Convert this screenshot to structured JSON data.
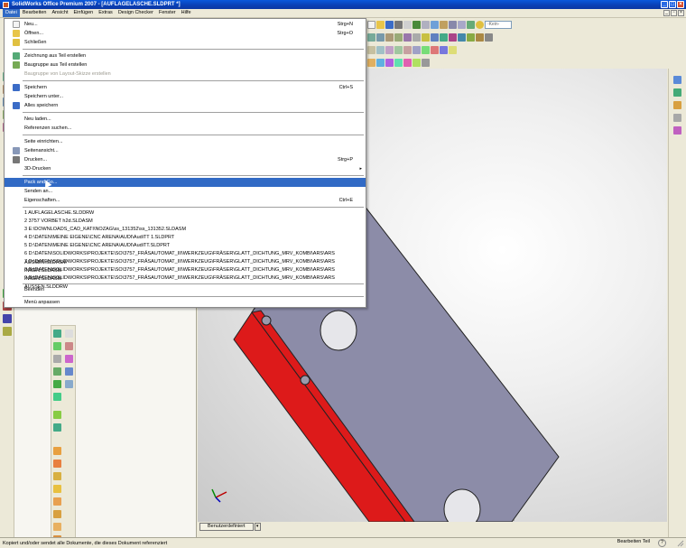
{
  "window": {
    "title": "SolidWorks Office Premium 2007 - [AUFLAGELASCHE.SLDPRT *]"
  },
  "menubar": {
    "items": [
      "Datei",
      "Bearbeiten",
      "Ansicht",
      "Einfügen",
      "Extras",
      "Design Checker",
      "Fenster",
      "Hilfe"
    ]
  },
  "toolbar": {
    "zoom_placeholder": "-Kein-"
  },
  "file_menu": {
    "items": [
      {
        "label": "Neu...",
        "shortcut": "Strg+N"
      },
      {
        "label": "Öffnen...",
        "shortcut": "Strg+O"
      },
      {
        "label": "Schließen",
        "shortcut": ""
      },
      {
        "label": "Zeichnung aus Teil erstellen",
        "shortcut": ""
      },
      {
        "label": "Baugruppe aus Teil erstellen",
        "shortcut": ""
      },
      {
        "label": "Baugruppe von Layout-Skizze erstellen",
        "shortcut": ""
      },
      {
        "label": "Speichern",
        "shortcut": "Ctrl+S"
      },
      {
        "label": "Speichern unter...",
        "shortcut": ""
      },
      {
        "label": "Alles speichern",
        "shortcut": ""
      },
      {
        "label": "Neu laden...",
        "shortcut": ""
      },
      {
        "label": "Referenzen suchen...",
        "shortcut": ""
      },
      {
        "label": "Seite einrichten...",
        "shortcut": ""
      },
      {
        "label": "Seitenansicht...",
        "shortcut": ""
      },
      {
        "label": "Drucken...",
        "shortcut": "Strg+P"
      },
      {
        "label": "3D-Drucken",
        "shortcut": ""
      },
      {
        "label": "Pack and Go...",
        "shortcut": ""
      },
      {
        "label": "Senden an...",
        "shortcut": ""
      },
      {
        "label": "Eigenschaften...",
        "shortcut": "Ctrl+E"
      },
      {
        "label": "Beenden",
        "shortcut": ""
      },
      {
        "label": "Menü anpassen",
        "shortcut": ""
      }
    ],
    "recent": [
      "1 AUFLAGELASCHE.SLDDRW",
      "2 3757 VORBET h2d.SLDASM",
      "3 E:\\DOWNLOADS_CAD_KATI\\NOZAG\\ss_131352\\ss_131352.SLDASM",
      "4 D:\\DATEN\\MEINE EIGENE\\CNC ARENA\\AUDI\\AudiTT 1.SLDPRT",
      "5 D:\\DATEN\\MEINE EIGENE\\CNC ARENA\\AUDI\\AudiTT.SLDPRT",
      "6 D:\\DATEN\\SOLIDWORKS\\PROJEKTE\\SO\\3757_FRÄSAUTOMAT_III\\WERKZEUG\\FRÄSER\\GLATT_DICHTUNG_MRV_KOMBI\\ARS\\ARS AUSSEN.SLDASM",
      "7 D:\\DATEN\\SOLIDWORKS\\PROJEKTE\\SO\\3757_FRÄSAUTOMAT_III\\WERKZEUG\\FRÄSER\\GLATT_DICHTUNG_MRV_KOMBI\\ARS\\ARS INNEN.SLDASM",
      "8 D:\\DATEN\\SOLIDWORKS\\PROJEKTE\\SO\\3757_FRÄSAUTOMAT_III\\WERKZEUG\\FRÄSER\\GLATT_DICHTUNG_MRV_KOMBI\\ARS\\ARS INNEN.SLDASM",
      "9 D:\\DATEN\\SOLIDWORKS\\PROJEKTE\\SO\\3757_FRÄSAUTOMAT_III\\WERKZEUG\\FRÄSER\\GLATT_DICHTUNG_MRV_KOMBI\\ARS\\ARS AUSSEN.SLDDRW"
    ]
  },
  "bottom_tab": {
    "label": "Benutzerdefiniert"
  },
  "statusbar": {
    "message": "Kopiert und/oder sendet alle Dokumente, die dieses Dokument referenziert",
    "mode": "Bearbeiten Teil",
    "help": "?"
  },
  "colors": {
    "menu_highlight": "#316ac5",
    "part_gray": "#8c8ca8",
    "part_red": "#dd1a1a"
  }
}
